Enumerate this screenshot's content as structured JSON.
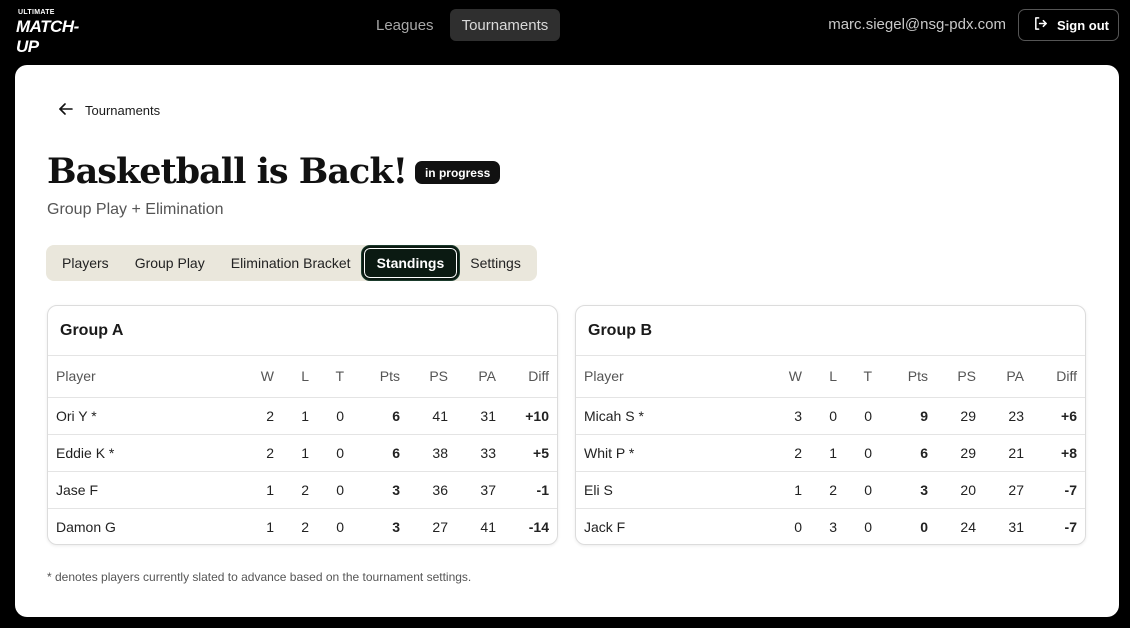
{
  "brand": {
    "small": "ULTIMATE",
    "big": "MATCH-UP"
  },
  "nav": {
    "leagues": "Leagues",
    "tournaments": "Tournaments"
  },
  "user": {
    "email": "marc.siegel@nsg-pdx.com",
    "sign_out": "Sign out"
  },
  "back_label": "Tournaments",
  "tournament": {
    "title": "Basketball is Back!",
    "status": "in progress",
    "format": "Group Play + Elimination"
  },
  "tabs": [
    "Players",
    "Group Play",
    "Elimination Bracket",
    "Standings",
    "Settings"
  ],
  "columns": [
    "Player",
    "W",
    "L",
    "T",
    "Pts",
    "PS",
    "PA",
    "Diff"
  ],
  "groups": [
    {
      "name": "Group A",
      "rows": [
        {
          "player": "Ori Y *",
          "w": "2",
          "l": "1",
          "t": "0",
          "pts": "6",
          "ps": "41",
          "pa": "31",
          "diff": "+10"
        },
        {
          "player": "Eddie K *",
          "w": "2",
          "l": "1",
          "t": "0",
          "pts": "6",
          "ps": "38",
          "pa": "33",
          "diff": "+5"
        },
        {
          "player": "Jase F",
          "w": "1",
          "l": "2",
          "t": "0",
          "pts": "3",
          "ps": "36",
          "pa": "37",
          "diff": "-1"
        },
        {
          "player": "Damon G",
          "w": "1",
          "l": "2",
          "t": "0",
          "pts": "3",
          "ps": "27",
          "pa": "41",
          "diff": "-14"
        }
      ]
    },
    {
      "name": "Group B",
      "rows": [
        {
          "player": "Micah S *",
          "w": "3",
          "l": "0",
          "t": "0",
          "pts": "9",
          "ps": "29",
          "pa": "23",
          "diff": "+6"
        },
        {
          "player": "Whit P *",
          "w": "2",
          "l": "1",
          "t": "0",
          "pts": "6",
          "ps": "29",
          "pa": "21",
          "diff": "+8"
        },
        {
          "player": "Eli S",
          "w": "1",
          "l": "2",
          "t": "0",
          "pts": "3",
          "ps": "20",
          "pa": "27",
          "diff": "-7"
        },
        {
          "player": "Jack F",
          "w": "0",
          "l": "3",
          "t": "0",
          "pts": "0",
          "ps": "24",
          "pa": "31",
          "diff": "-7"
        }
      ]
    }
  ],
  "footnote": "* denotes players currently slated to advance based on the tournament settings."
}
